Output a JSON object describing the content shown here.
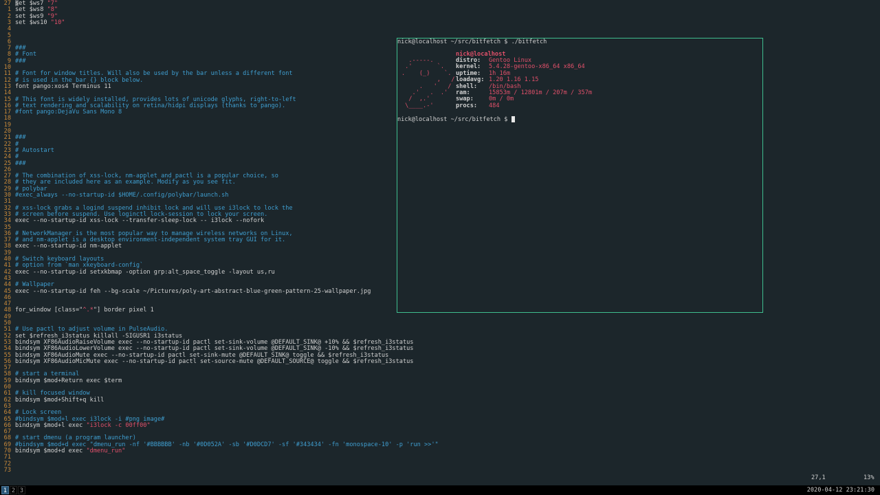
{
  "editor": {
    "lines": [
      {
        "n": "27",
        "parts": [
          [
            "code",
            "set $ws7 "
          ],
          [
            "string",
            "\"7\""
          ]
        ]
      },
      {
        "n": "1",
        "parts": [
          [
            "code",
            "set $ws8 "
          ],
          [
            "string",
            "\"8\""
          ]
        ]
      },
      {
        "n": "2",
        "parts": [
          [
            "code",
            "set $ws9 "
          ],
          [
            "string",
            "\"9\""
          ]
        ]
      },
      {
        "n": "3",
        "parts": [
          [
            "code",
            "set $ws10 "
          ],
          [
            "string",
            "\"10\""
          ]
        ]
      },
      {
        "n": "4",
        "parts": []
      },
      {
        "n": "5",
        "parts": []
      },
      {
        "n": "6",
        "parts": []
      },
      {
        "n": "7",
        "parts": [
          [
            "comment",
            "###"
          ]
        ]
      },
      {
        "n": "8",
        "parts": [
          [
            "comment",
            "# Font"
          ]
        ]
      },
      {
        "n": "9",
        "parts": [
          [
            "comment",
            "###"
          ]
        ]
      },
      {
        "n": "10",
        "parts": []
      },
      {
        "n": "11",
        "parts": [
          [
            "comment",
            "# Font for window titles. Will also be used by the bar unless a different font"
          ]
        ]
      },
      {
        "n": "12",
        "parts": [
          [
            "comment",
            "# is used in the bar {} block below."
          ]
        ]
      },
      {
        "n": "13",
        "parts": [
          [
            "code",
            "font pango:xos4 Terminus 11"
          ]
        ]
      },
      {
        "n": "14",
        "parts": []
      },
      {
        "n": "15",
        "parts": [
          [
            "comment",
            "# This font is widely installed, provides lots of unicode glyphs, right-to-left"
          ]
        ]
      },
      {
        "n": "16",
        "parts": [
          [
            "comment",
            "# text rendering and scalability on retina/hidpi displays (thanks to pango)."
          ]
        ]
      },
      {
        "n": "17",
        "parts": [
          [
            "comment",
            "#font pango:DejaVu Sans Mono 8"
          ]
        ]
      },
      {
        "n": "18",
        "parts": []
      },
      {
        "n": "19",
        "parts": []
      },
      {
        "n": "20",
        "parts": []
      },
      {
        "n": "21",
        "parts": [
          [
            "comment",
            "###"
          ]
        ]
      },
      {
        "n": "22",
        "parts": [
          [
            "comment",
            "#"
          ]
        ]
      },
      {
        "n": "23",
        "parts": [
          [
            "comment",
            "# Autostart"
          ]
        ]
      },
      {
        "n": "24",
        "parts": [
          [
            "comment",
            "#"
          ]
        ]
      },
      {
        "n": "25",
        "parts": [
          [
            "comment",
            "###"
          ]
        ]
      },
      {
        "n": "26",
        "parts": []
      },
      {
        "n": "27",
        "parts": [
          [
            "comment",
            "# The combination of xss-lock, nm-applet and pactl is a popular choice, so"
          ]
        ]
      },
      {
        "n": "28",
        "parts": [
          [
            "comment",
            "# they are included here as an example. Modify as you see fit."
          ]
        ]
      },
      {
        "n": "29",
        "parts": [
          [
            "comment",
            "# polybar"
          ]
        ]
      },
      {
        "n": "30",
        "parts": [
          [
            "comment",
            "#exec_always --no-startup-id $HOME/.config/polybar/launch.sh"
          ]
        ]
      },
      {
        "n": "31",
        "parts": []
      },
      {
        "n": "32",
        "parts": [
          [
            "comment",
            "# xss-lock grabs a logind suspend inhibit lock and will use i3lock to lock the"
          ]
        ]
      },
      {
        "n": "33",
        "parts": [
          [
            "comment",
            "# screen before suspend. Use loginctl lock-session to lock your screen."
          ]
        ]
      },
      {
        "n": "34",
        "parts": [
          [
            "code",
            "exec --no-startup-id xss-lock --transfer-sleep-lock -- i3lock --nofork"
          ]
        ]
      },
      {
        "n": "35",
        "parts": []
      },
      {
        "n": "36",
        "parts": [
          [
            "comment",
            "# NetworkManager is the most popular way to manage wireless networks on Linux,"
          ]
        ]
      },
      {
        "n": "37",
        "parts": [
          [
            "comment",
            "# and nm-applet is a desktop environment-independent system tray GUI for it."
          ]
        ]
      },
      {
        "n": "38",
        "parts": [
          [
            "code",
            "exec --no-startup-id nm-applet"
          ]
        ]
      },
      {
        "n": "39",
        "parts": []
      },
      {
        "n": "40",
        "parts": [
          [
            "comment",
            "# Switch keyboard layouts"
          ]
        ]
      },
      {
        "n": "41",
        "parts": [
          [
            "comment",
            "# option from `man xkeyboard-config`"
          ]
        ]
      },
      {
        "n": "42",
        "parts": [
          [
            "code",
            "exec --no-startup-id setxkbmap -option grp:alt_space_toggle -layout us,ru"
          ]
        ]
      },
      {
        "n": "43",
        "parts": []
      },
      {
        "n": "44",
        "parts": [
          [
            "comment",
            "# Wallpaper"
          ]
        ]
      },
      {
        "n": "45",
        "parts": [
          [
            "code",
            "exec --no-startup-id feh --bg-scale ~/Pictures/poly-art-abstract-blue-green-pattern-25-wallpaper.jpg"
          ]
        ]
      },
      {
        "n": "46",
        "parts": []
      },
      {
        "n": "47",
        "parts": []
      },
      {
        "n": "48",
        "parts": [
          [
            "code",
            "for_window [class=\""
          ],
          [
            "string",
            "^.*"
          ],
          [
            "code",
            "\"] border pixel 1"
          ]
        ]
      },
      {
        "n": "49",
        "parts": []
      },
      {
        "n": "50",
        "parts": []
      },
      {
        "n": "51",
        "parts": [
          [
            "comment",
            "# Use pactl to adjust volume in PulseAudio."
          ]
        ]
      },
      {
        "n": "52",
        "parts": [
          [
            "code",
            "set $refresh_i3status killall -SIGUSR1 i3status"
          ]
        ]
      },
      {
        "n": "53",
        "parts": [
          [
            "code",
            "bindsym XF86AudioRaiseVolume exec --no-startup-id pactl set-sink-volume @DEFAULT_SINK@ +10% && $refresh_i3status"
          ]
        ]
      },
      {
        "n": "54",
        "parts": [
          [
            "code",
            "bindsym XF86AudioLowerVolume exec --no-startup-id pactl set-sink-volume @DEFAULT_SINK@ -10% && $refresh_i3status"
          ]
        ]
      },
      {
        "n": "55",
        "parts": [
          [
            "code",
            "bindsym XF86AudioMute exec --no-startup-id pactl set-sink-mute @DEFAULT_SINK@ toggle && $refresh_i3status"
          ]
        ]
      },
      {
        "n": "56",
        "parts": [
          [
            "code",
            "bindsym XF86AudioMicMute exec --no-startup-id pactl set-source-mute @DEFAULT_SOURCE@ toggle && $refresh_i3status"
          ]
        ]
      },
      {
        "n": "57",
        "parts": []
      },
      {
        "n": "58",
        "parts": [
          [
            "comment",
            "# start a terminal"
          ]
        ]
      },
      {
        "n": "59",
        "parts": [
          [
            "code",
            "bindsym $mod+Return exec $term"
          ]
        ]
      },
      {
        "n": "60",
        "parts": []
      },
      {
        "n": "61",
        "parts": [
          [
            "comment",
            "# kill focused window"
          ]
        ]
      },
      {
        "n": "62",
        "parts": [
          [
            "code",
            "bindsym $mod+Shift+q kill"
          ]
        ]
      },
      {
        "n": "63",
        "parts": []
      },
      {
        "n": "64",
        "parts": [
          [
            "comment",
            "# Lock screen"
          ]
        ]
      },
      {
        "n": "65",
        "parts": [
          [
            "comment",
            "#bindsym $mod+l exec i3lock -i #png image#"
          ]
        ]
      },
      {
        "n": "66",
        "parts": [
          [
            "code",
            "bindsym $mod+l exec "
          ],
          [
            "string",
            "\"i3lock -c 00ff00\""
          ]
        ]
      },
      {
        "n": "67",
        "parts": []
      },
      {
        "n": "68",
        "parts": [
          [
            "comment",
            "# start dmenu (a program launcher)"
          ]
        ]
      },
      {
        "n": "69",
        "parts": [
          [
            "comment",
            "#bindsym $mod+d exec \"dmenu_run -nf '#BBBBBB' -nb '#0D052A' -sb '#D0DCD7' -sf '#343434' -fn 'monospace-10' -p 'run >>'\""
          ]
        ]
      },
      {
        "n": "70",
        "parts": [
          [
            "code",
            "bindsym $mod+d exec "
          ],
          [
            "string",
            "\"dmenu_run\""
          ]
        ]
      },
      {
        "n": "71",
        "parts": []
      },
      {
        "n": "72",
        "parts": []
      },
      {
        "n": "73",
        "parts": []
      }
    ],
    "position": "27,1",
    "scroll_percent": "13%"
  },
  "terminal": {
    "prompt1": "nick@localhost ~/src/bitfetch $ ./bitfetch",
    "ascii_art": [
      "  .-----.",
      " .'       `.",
      ".    (_)    `.",
      "          ,   /",
      "     .   '   /",
      "   .'   .  .'",
      "  /  ,.'",
      " \\____.-'"
    ],
    "user_host": "nick@localhost",
    "info": [
      {
        "key": "distro:",
        "value": "Gentoo Linux"
      },
      {
        "key": "kernel:",
        "value": "5.4.28-gentoo-x86_64 x86_64"
      },
      {
        "key": "uptime:",
        "value": "1h 16m"
      },
      {
        "key": "loadavg:",
        "value": "1.20 1.16 1.15"
      },
      {
        "key": "shell:",
        "value": "/bin/bash"
      },
      {
        "key": "ram:",
        "value": "15853m / 12801m / 207m / 357m"
      },
      {
        "key": "swap:",
        "value": "0m / 0m"
      },
      {
        "key": "procs:",
        "value": "484"
      }
    ],
    "prompt2": "nick@localhost ~/src/bitfetch $ "
  },
  "bar": {
    "workspaces": [
      "1",
      "2",
      "3"
    ],
    "active_workspace": "1",
    "clock": "2020-04-12 23:21:30"
  },
  "colors": {
    "background": "#1c262b",
    "comment": "#3f9ed0",
    "string": "#e0506a",
    "line_number": "#c98a3b",
    "terminal_border": "#3fbf8f",
    "active_workspace": "#285577"
  }
}
